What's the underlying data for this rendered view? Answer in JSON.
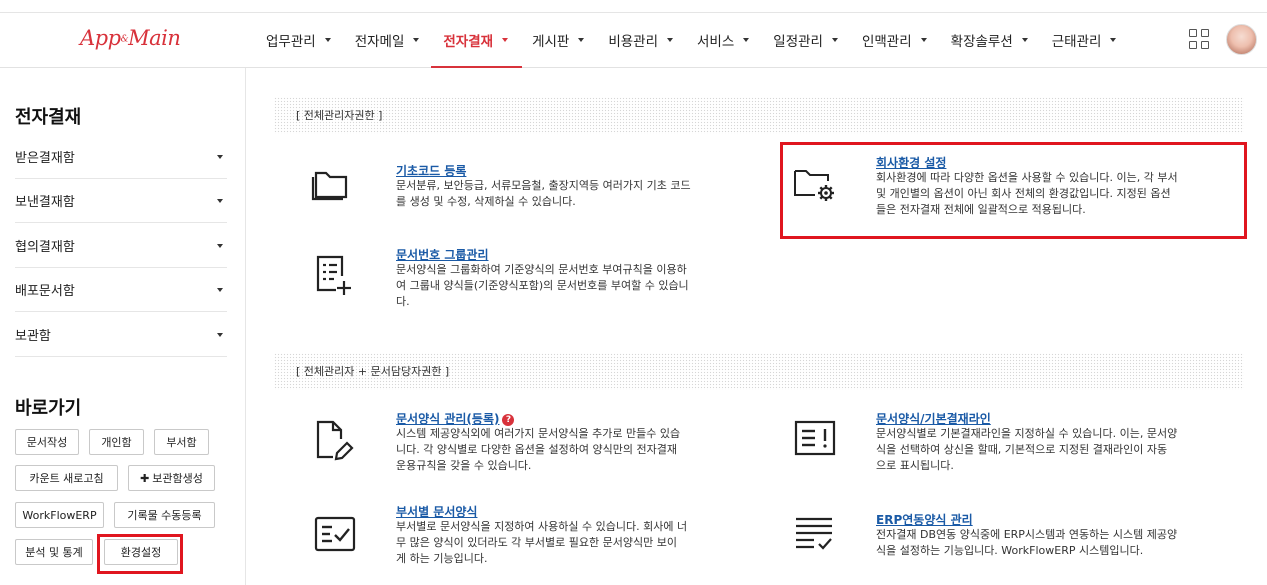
{
  "logo": {
    "text": "App",
    "sub": "&",
    "text2": "Main"
  },
  "nav": [
    {
      "label": "업무관리"
    },
    {
      "label": "전자메일"
    },
    {
      "label": "전자결재",
      "active": true
    },
    {
      "label": "게시판"
    },
    {
      "label": "비용관리"
    },
    {
      "label": "서비스"
    },
    {
      "label": "일정관리"
    },
    {
      "label": "인맥관리"
    },
    {
      "label": "확장솔루션"
    },
    {
      "label": "근태관리"
    }
  ],
  "sidebar": {
    "title": "전자결재",
    "items": [
      "받은결재함",
      "보낸결재함",
      "협의결재함",
      "배포문서함",
      "보관함"
    ],
    "shortcut_title": "바로가기",
    "shortcuts": [
      "문서작성",
      "개인함",
      "부서함",
      "카운트 새로고침",
      "보관함생성",
      "WorkFlowERP",
      "기록물 수동등록",
      "분석 및 통계",
      "환경설정"
    ]
  },
  "sections": [
    {
      "header": "[ 전체관리자권한 ]"
    },
    {
      "header": "[ 전체관리자 + 문서담당자권한 ]"
    }
  ],
  "items": {
    "basic_code": {
      "title": "기초코드 등록",
      "desc": [
        "문서분류, 보안등급, 서류모음철, 출장지역등 여러가지 기초 코드",
        "를 생성 및 수정, 삭제하실 수 있습니다."
      ]
    },
    "company_env": {
      "title": "회사환경 설정",
      "desc": [
        "회사환경에 따라 다양한 옵션을 사용할 수 있습니다. 이는, 각 부서",
        "및 개인별의 옵션이 아닌 회사 전체의 환경값입니다. 지정된 옵션",
        "들은 전자결재 전체에 일괄적으로 적용됩니다."
      ]
    },
    "doc_number": {
      "title": "문서번호 그룹관리",
      "desc": [
        "문서양식을 그룹화하여 기준양식의 문서번호 부여규칙을 이용하",
        "여 그룹내 양식들(기준양식포함)의 문서번호를 부여할 수 있습니",
        "다."
      ]
    },
    "form_manage": {
      "title": "문서양식 관리(등록)",
      "help": "?",
      "desc": [
        "시스템 제공양식외에 여러가지 문서양식을 추가로 만들수 있습",
        "니다. 각 양식별로 다양한 옵션을 설정하여 양식만의 전자결재",
        "운용규칙을 갖을 수 있습니다."
      ]
    },
    "approval_line": {
      "title": "문서양식/기본결재라인",
      "desc": [
        "문서양식별로 기본결재라인을 지정하실 수 있습니다. 이는, 문서양",
        "식을 선택하여 상신을 할때, 기본적으로 지정된 결재라인이 자동",
        "으로 표시됩니다."
      ]
    },
    "dept_form": {
      "title": "부서별 문서양식",
      "desc": [
        "부서별로 문서양식을 지정하여 사용하실 수 있습니다. 회사에 너",
        "무 많은 양식이 있더라도 각 부서별로 필요한 문서양식만 보이",
        "게 하는 기능입니다."
      ]
    },
    "erp_form": {
      "title": "ERP연동양식 관리",
      "desc": [
        "전자결재 DB연동 양식중에 ERP시스템과 연동하는 시스템 제공양",
        "식을 설정하는 기능입니다. WorkFlowERP 시스템입니다."
      ]
    }
  },
  "colors": {
    "accent": "#d8323b",
    "link": "#1a5aa6",
    "highlight": "#e0161f"
  }
}
